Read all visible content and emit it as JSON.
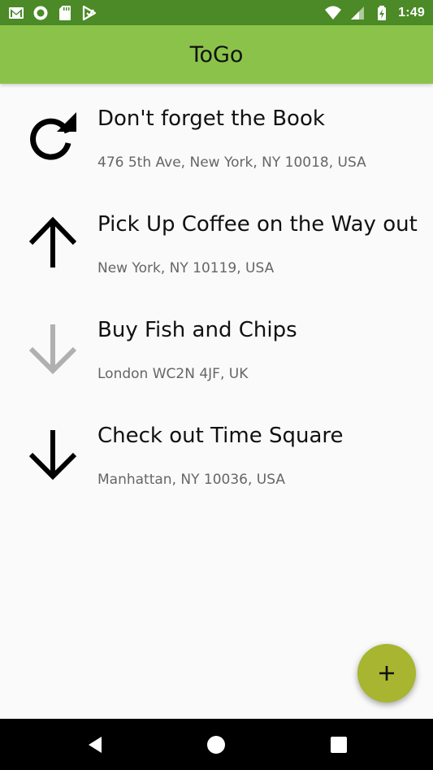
{
  "status_bar": {
    "time": "1:49",
    "left_icons": [
      "gmail-icon",
      "record-icon",
      "sd-card-icon",
      "play-store-icon"
    ],
    "right_icons": [
      "wifi-icon",
      "signal-icon",
      "battery-charging-icon"
    ]
  },
  "app_bar": {
    "title": "ToGo",
    "color": "#8bc34a"
  },
  "items": [
    {
      "title": "Don't forget the Book",
      "subtitle": "476 5th Ave, New York, NY 10018, USA",
      "icon": "refresh-icon",
      "icon_color": "#000000"
    },
    {
      "title": "Pick Up Coffee on the Way out",
      "subtitle": "New York, NY 10119, USA",
      "icon": "arrow-up-icon",
      "icon_color": "#000000"
    },
    {
      "title": "Buy Fish and Chips",
      "subtitle": "London WC2N 4JF, UK",
      "icon": "arrow-down-icon",
      "icon_color": "#b0b0b0"
    },
    {
      "title": "Check out Time Square",
      "subtitle": "Manhattan, NY 10036, USA",
      "icon": "arrow-down-icon",
      "icon_color": "#000000"
    }
  ],
  "fab": {
    "icon": "plus-icon",
    "color": "#a8b530"
  },
  "nav_bar": {
    "buttons": [
      "back-icon",
      "home-icon",
      "recents-icon"
    ]
  }
}
